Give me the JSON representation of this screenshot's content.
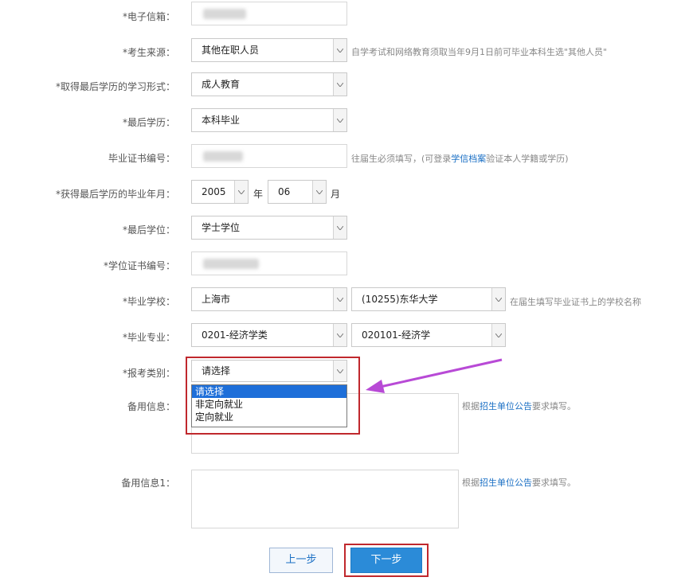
{
  "form": {
    "email_label": "*电子信箱：",
    "source_label": "*考生来源：",
    "source_value": "其他在职人员",
    "source_hint": "自学考试和网络教育须取当年9月1日前可毕业本科生选\"其他人员\"",
    "study_form_label": "*取得最后学历的学习形式：",
    "study_form_value": "成人教育",
    "last_edu_label": "*最后学历：",
    "last_edu_value": "本科毕业",
    "cert_no_label": "毕业证书编号：",
    "cert_no_hint_a": "往届生必须填写，(可登录",
    "cert_no_hint_link": "学信档案",
    "cert_no_hint_b": "验证本人学籍或学历)",
    "grad_date_label": "*获得最后学历的毕业年月：",
    "grad_year": "2005",
    "year_unit": "年",
    "grad_month": "06",
    "month_unit": "月",
    "degree_label": "*最后学位：",
    "degree_value": "学士学位",
    "degree_cert_label": "*学位证书编号：",
    "school_label": "*毕业学校：",
    "school_city": "上海市",
    "school_name": "(10255)东华大学",
    "school_hint": "在届生填写毕业证书上的学校名称",
    "major_label": "*毕业专业：",
    "major_category": "0201-经济学类",
    "major_name": "020101-经济学",
    "category_label": "*报考类别：",
    "category_value": "请选择",
    "category_options": [
      "请选择",
      "非定向就业",
      "定向就业"
    ],
    "backup_label": "备用信息：",
    "backup_hint_a": "根据",
    "backup_hint_link": "招生单位公告",
    "backup_hint_b": "要求填写。",
    "backup1_label": "备用信息1：",
    "backup1_hint_a": "根据",
    "backup1_hint_link": "招生单位公告",
    "backup1_hint_b": "要求填写。"
  },
  "buttons": {
    "prev": "上一步",
    "next": "下一步"
  },
  "colors": {
    "highlight_box": "#c0282d",
    "arrow": "#b84ad6",
    "selected_option_bg": "#1e6fd9",
    "primary_button": "#2b8bd8",
    "link": "#1a6fc4"
  }
}
